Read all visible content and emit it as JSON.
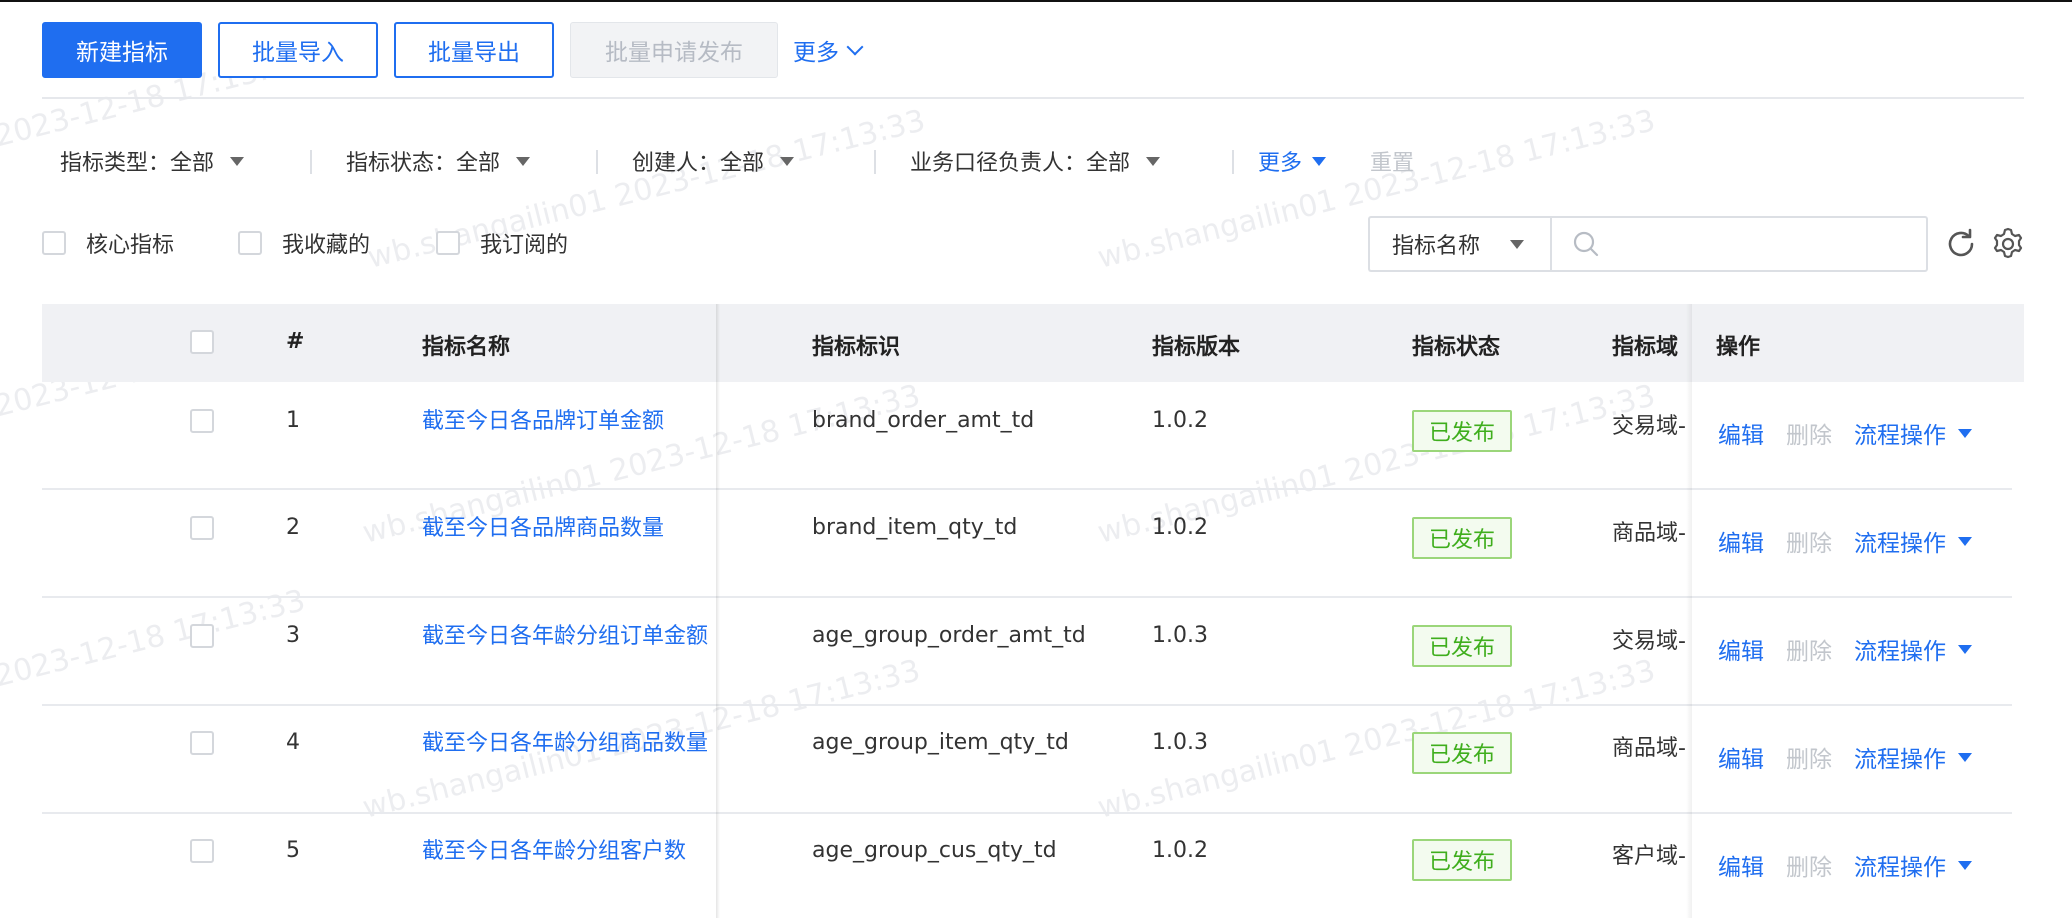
{
  "toolbar": {
    "new_label": "新建指标",
    "import_label": "批量导入",
    "export_label": "批量导出",
    "publish_label": "批量申请发布",
    "more_label": "更多"
  },
  "filters": {
    "type_label": "指标类型：全部",
    "status_label": "指标状态：全部",
    "creator_label": "创建人：全部",
    "owner_label": "业务口径负责人：全部",
    "more_label": "更多",
    "reset_label": "重置"
  },
  "checks": {
    "core": "核心指标",
    "fav": "我收藏的",
    "sub": "我订阅的"
  },
  "search": {
    "field": "指标名称",
    "value": ""
  },
  "table": {
    "headers": {
      "index": "#",
      "name": "指标名称",
      "code": "指标标识",
      "version": "指标版本",
      "status": "指标状态",
      "domain": "指标域",
      "ops": "操作"
    },
    "rows": [
      {
        "index": "1",
        "name": "截至今日各品牌订单金额",
        "code": "brand_order_amt_td",
        "version": "1.0.2",
        "status": "已发布",
        "domain": "交易域-"
      },
      {
        "index": "2",
        "name": "截至今日各品牌商品数量",
        "code": "brand_item_qty_td",
        "version": "1.0.2",
        "status": "已发布",
        "domain": "商品域-"
      },
      {
        "index": "3",
        "name": "截至今日各年龄分组订单金额",
        "code": "age_group_order_amt_td",
        "version": "1.0.3",
        "status": "已发布",
        "domain": "交易域-"
      },
      {
        "index": "4",
        "name": "截至今日各年龄分组商品数量",
        "code": "age_group_item_qty_td",
        "version": "1.0.3",
        "status": "已发布",
        "domain": "商品域-"
      },
      {
        "index": "5",
        "name": "截至今日各年龄分组客户数",
        "code": "age_group_cus_qty_td",
        "version": "1.0.2",
        "status": "已发布",
        "domain": "客户域-"
      }
    ],
    "op_edit": "编辑",
    "op_delete": "删除",
    "op_flow": "流程操作"
  },
  "watermark": {
    "text": "wb.shangailin01 2023-12-18 17:13:33"
  },
  "colors": {
    "primary": "#1f6ef0",
    "success": "#3fae1d",
    "disabled": "#c2c6cc"
  }
}
